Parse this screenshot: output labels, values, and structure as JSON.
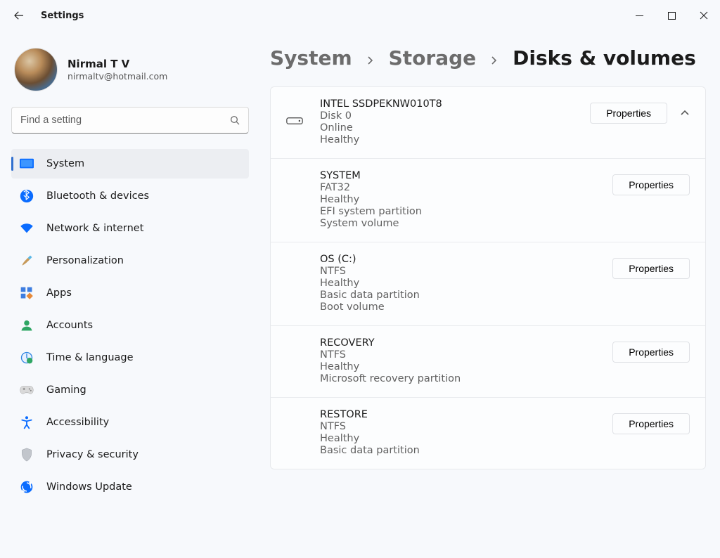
{
  "app": {
    "title": "Settings"
  },
  "user": {
    "name": "Nirmal T V",
    "email": "nirmaltv@hotmail.com"
  },
  "search": {
    "placeholder": "Find a setting"
  },
  "sidebar": {
    "items": [
      {
        "label": "System"
      },
      {
        "label": "Bluetooth & devices"
      },
      {
        "label": "Network & internet"
      },
      {
        "label": "Personalization"
      },
      {
        "label": "Apps"
      },
      {
        "label": "Accounts"
      },
      {
        "label": "Time & language"
      },
      {
        "label": "Gaming"
      },
      {
        "label": "Accessibility"
      },
      {
        "label": "Privacy & security"
      },
      {
        "label": "Windows Update"
      }
    ]
  },
  "breadcrumb": {
    "a": "System",
    "b": "Storage",
    "c": "Disks & volumes"
  },
  "disk": {
    "title": "INTEL SSDPEKNW010T8",
    "lines": [
      "Disk 0",
      "Online",
      "Healthy"
    ],
    "properties_label": "Properties"
  },
  "vols": [
    {
      "title": "SYSTEM",
      "lines": [
        "FAT32",
        "Healthy",
        "EFI system partition",
        "System volume"
      ],
      "properties_label": "Properties"
    },
    {
      "title": "OS (C:)",
      "lines": [
        "NTFS",
        "Healthy",
        "Basic data partition",
        "Boot volume"
      ],
      "properties_label": "Properties"
    },
    {
      "title": "RECOVERY",
      "lines": [
        "NTFS",
        "Healthy",
        "Microsoft recovery partition"
      ],
      "properties_label": "Properties"
    },
    {
      "title": "RESTORE",
      "lines": [
        "NTFS",
        "Healthy",
        "Basic data partition"
      ],
      "properties_label": "Properties"
    }
  ]
}
